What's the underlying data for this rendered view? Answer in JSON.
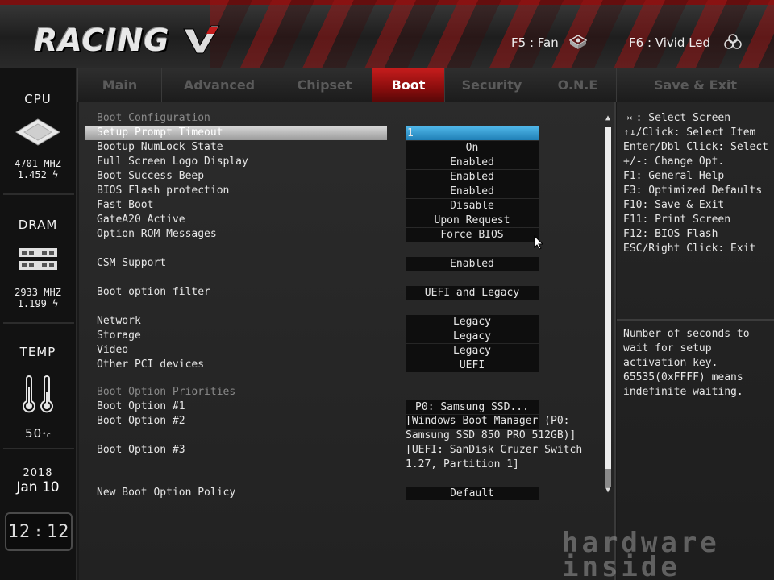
{
  "header": {
    "logo_text": "RACING",
    "hotkeys": [
      {
        "label": "F5 : Fan"
      },
      {
        "label": "F6 : Vivid Led"
      }
    ]
  },
  "sidebar": {
    "cpu": {
      "title": "CPU",
      "freq": "4701 MHZ",
      "volt": "1.452"
    },
    "dram": {
      "title": "DRAM",
      "freq": "2933 MHZ",
      "volt": "1.199"
    },
    "temp": {
      "title": "TEMP",
      "value": "50",
      "unit": "°c"
    },
    "date": {
      "year": "2018",
      "day": "Jan 10"
    },
    "clock": {
      "hour": "12",
      "minute": "12"
    }
  },
  "tabs": [
    {
      "label": "Main"
    },
    {
      "label": "Advanced"
    },
    {
      "label": "Chipset"
    },
    {
      "label": "Boot",
      "active": true
    },
    {
      "label": "Security"
    },
    {
      "label": "O.N.E"
    },
    {
      "label": "Save & Exit"
    }
  ],
  "boot": {
    "section_config": "Boot Configuration",
    "items": [
      {
        "label": "Setup Prompt Timeout",
        "value": "1"
      },
      {
        "label": "Bootup NumLock State",
        "value": "On"
      },
      {
        "label": "Full Screen Logo Display",
        "value": "Enabled"
      },
      {
        "label": "Boot Success Beep",
        "value": "Enabled"
      },
      {
        "label": "BIOS Flash protection",
        "value": "Enabled"
      },
      {
        "label": "Fast Boot",
        "value": "Disable"
      },
      {
        "label": "GateA20 Active",
        "value": "Upon Request"
      },
      {
        "label": "Option ROM Messages",
        "value": "Force BIOS"
      }
    ],
    "csm": {
      "label": "CSM Support",
      "value": "Enabled"
    },
    "filter": {
      "label": "Boot option filter",
      "value": "UEFI and Legacy"
    },
    "devices": [
      {
        "label": "Network",
        "value": "Legacy"
      },
      {
        "label": "Storage",
        "value": "Legacy"
      },
      {
        "label": "Video",
        "value": "Legacy"
      },
      {
        "label": "Other PCI devices",
        "value": "UEFI"
      }
    ],
    "section_priorities": "Boot Option Priorities",
    "options": [
      {
        "label": "Boot Option #1",
        "value": "P0: Samsung SSD..."
      },
      {
        "label": "Boot Option #2",
        "line1": "[Windows Boot Manager (P0:",
        "line2": "Samsung SSD 850 PRO 512GB)]"
      },
      {
        "label": "Boot Option #3",
        "line1": "[UEFI: SanDisk Cruzer Switch",
        "line2": "1.27, Partition 1]"
      }
    ],
    "policy": {
      "label": "New Boot Option Policy",
      "value": "Default"
    }
  },
  "help": {
    "keys": [
      "→←: Select Screen",
      "↑↓/Click: Select Item",
      "Enter/Dbl Click: Select",
      "+/-: Change Opt.",
      "F1: General Help",
      "F3: Optimized Defaults",
      "F10: Save & Exit",
      "F11: Print Screen",
      "F12: BIOS Flash",
      "ESC/Right Click: Exit"
    ],
    "description": [
      "Number of seconds to",
      "wait for setup",
      "activation key.",
      "65535(0xFFFF) means",
      "indefinite waiting."
    ]
  },
  "watermark": {
    "line1": "hardware",
    "line2": "inside"
  }
}
